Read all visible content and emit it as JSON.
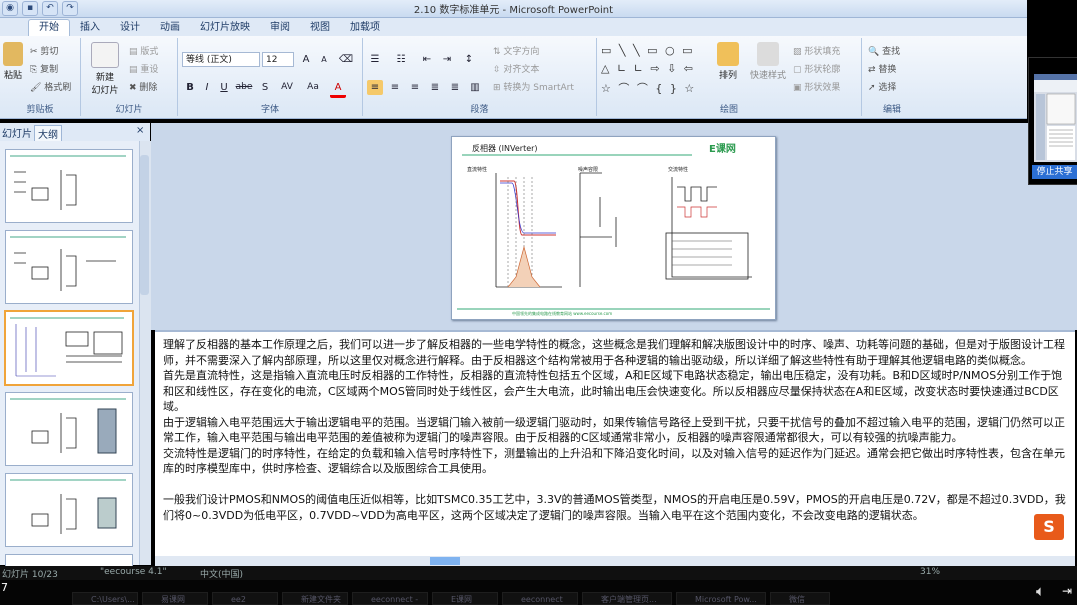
{
  "window": {
    "title": "2.10 数字标准单元 - Microsoft PowerPoint"
  },
  "tabs": [
    "开始",
    "插入",
    "设计",
    "动画",
    "幻灯片放映",
    "审阅",
    "视图",
    "加载项"
  ],
  "ribbon": {
    "clipboard": {
      "label": "剪贴板",
      "paste": "粘贴",
      "cut": "剪切",
      "copy": "复制",
      "format_painter": "格式刷"
    },
    "slides": {
      "label": "幻灯片",
      "new_slide": "新建\n幻灯片",
      "layout": "版式",
      "reset": "重设",
      "delete": "删除"
    },
    "font": {
      "label": "字体",
      "font_name": "等线 (正文)",
      "font_size": "12",
      "bold": "B",
      "italic": "I",
      "underline": "U",
      "strike": "abe",
      "shadow": "S",
      "spacing": "AV",
      "case": "Aa",
      "color": "A"
    },
    "paragraph": {
      "label": "段落",
      "text_direction": "文字方向",
      "align_text": "对齐文本",
      "smartart": "转换为 SmartArt"
    },
    "drawing": {
      "label": "绘图",
      "arrange": "排列",
      "quick_styles": "快速样式",
      "shape_fill": "形状填充",
      "shape_outline": "形状轮廓",
      "shape_effects": "形状效果"
    },
    "editing": {
      "label": "编辑",
      "find": "查找",
      "replace": "替换",
      "select": "选择"
    }
  },
  "panel": {
    "tab_slides": "幻灯片",
    "tab_outline": "大纲",
    "close": "×",
    "slide_numbers": [
      "",
      "",
      "",
      "",
      "",
      "",
      ""
    ]
  },
  "slide": {
    "title": "反相器 (INVerter)",
    "logo": "E课网",
    "sub1": "直流特性",
    "sub2": "噪声容限",
    "sub3": "交流特性",
    "footer": "中国领先的集成电路在线教育网站 www.eecourse.com"
  },
  "notes": [
    "理解了反相器的基本工作原理之后，我们可以进一步了解反相器的一些电学特性的概念，这些概念是我们理解和解决版图设计中的时序、噪声、功耗等问题的基础，但是对于版图设计工程师，并不需要深入了解内部原理，所以这里仅对概念进行解释。由于反相器这个结构常被用于各种逻辑的输出驱动级，所以详细了解这些特性有助于理解其他逻辑电路的类似概念。",
    "首先是直流特性，这是指输入直流电压时反相器的工作特性，反相器的直流特性包括五个区域，A和E区域下电路状态稳定，输出电压稳定，没有功耗。B和D区域时P/NMOS分别工作于饱和区和线性区，存在变化的电流，C区域两个MOS管同时处于线性区，会产生大电流，此时输出电压会快速变化。所以反相器应尽量保持状态在A和E区域，改变状态时要快速通过BCD区域。",
    "由于逻辑输入电平范围远大于输出逻辑电平的范围。当逻辑门输入被前一级逻辑门驱动时，如果传输信号路径上受到干扰，只要干扰信号的叠加不超过输入电平的范围，逻辑门仍然可以正常工作，输入电平范围与输出电平范围的差值被称为逻辑门的噪声容限。由于反相器的C区域通常非常小，反相器的噪声容限通常都很大，可以有较强的抗噪声能力。",
    "交流特性是逻辑门的时序特性，在给定的负载和输入信号时序特性下，测量输出的上升沿和下降沿变化时间，以及对输入信号的延迟作为门延迟。通常会把它做出时序特性表，包含在单元库的时序模型库中，供时序检查、逻辑综合以及版图综合工具使用。",
    "",
    "一般我们设计PMOS和NMOS的阈值电压近似相等，比如TSMC0.35工艺中，3.3V的普通MOS管类型，NMOS的开启电压是0.59V，PMOS的开启电压是0.72V，都是不超过0.3VDD，我们将0~0.3VDD为低电平区，0.7VDD~VDD为高电平区，这两个区域决定了逻辑门的噪声容限。当输入电平在这个范围内变化，不会改变电路的逻辑状态。"
  ],
  "status": {
    "slide_info": "幻灯片 10/23",
    "theme": "\"eecourse 4.1\"",
    "lang": "中文(中国)",
    "zoom": "31%"
  },
  "overlay": {
    "stop_share": "停止共享"
  },
  "taskbar": {
    "items": [
      "C:\\Users\\...",
      "易课网",
      "ee2",
      "新建文件夹",
      "eeconnect - 图...",
      "E课网",
      "eeconnect",
      "客户端管理页...",
      "Microsoft Pow...",
      "微信"
    ]
  },
  "colors": {
    "ribbon": "#dbe7f5",
    "accent": "#f0a43a",
    "taskbar": "#050505"
  }
}
